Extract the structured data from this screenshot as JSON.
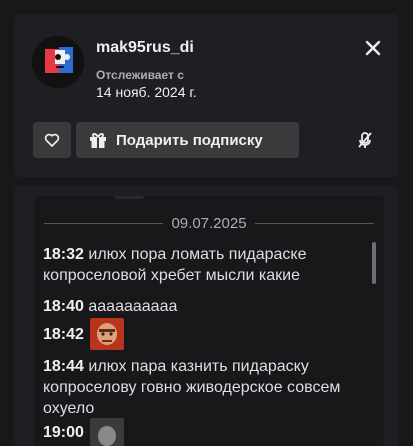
{
  "profile": {
    "username": "mak95rus_di",
    "follow_label": "Отслеживает с",
    "follow_date": "14 нояб. 2024 г."
  },
  "actions": {
    "gift_label": "Подарить подписку"
  },
  "chat": {
    "date": "09.07.2025",
    "messages": [
      {
        "time": "18:32",
        "text": "илюх пора ломать пидараске копроселовой хребет мысли какие"
      },
      {
        "time": "18:40",
        "text": "аааааааааа"
      },
      {
        "time": "18:42",
        "text": ""
      },
      {
        "time": "18:44",
        "text": "илюх пара казнить пидараску копроселову говно живодерское совсем охуело"
      },
      {
        "time": "19:00",
        "text": ""
      }
    ]
  },
  "colors": {
    "background": "#18181b",
    "card": "#1f1f23",
    "button": "#3a3a3d",
    "text": "#efeff1",
    "muted": "#adadb8"
  }
}
